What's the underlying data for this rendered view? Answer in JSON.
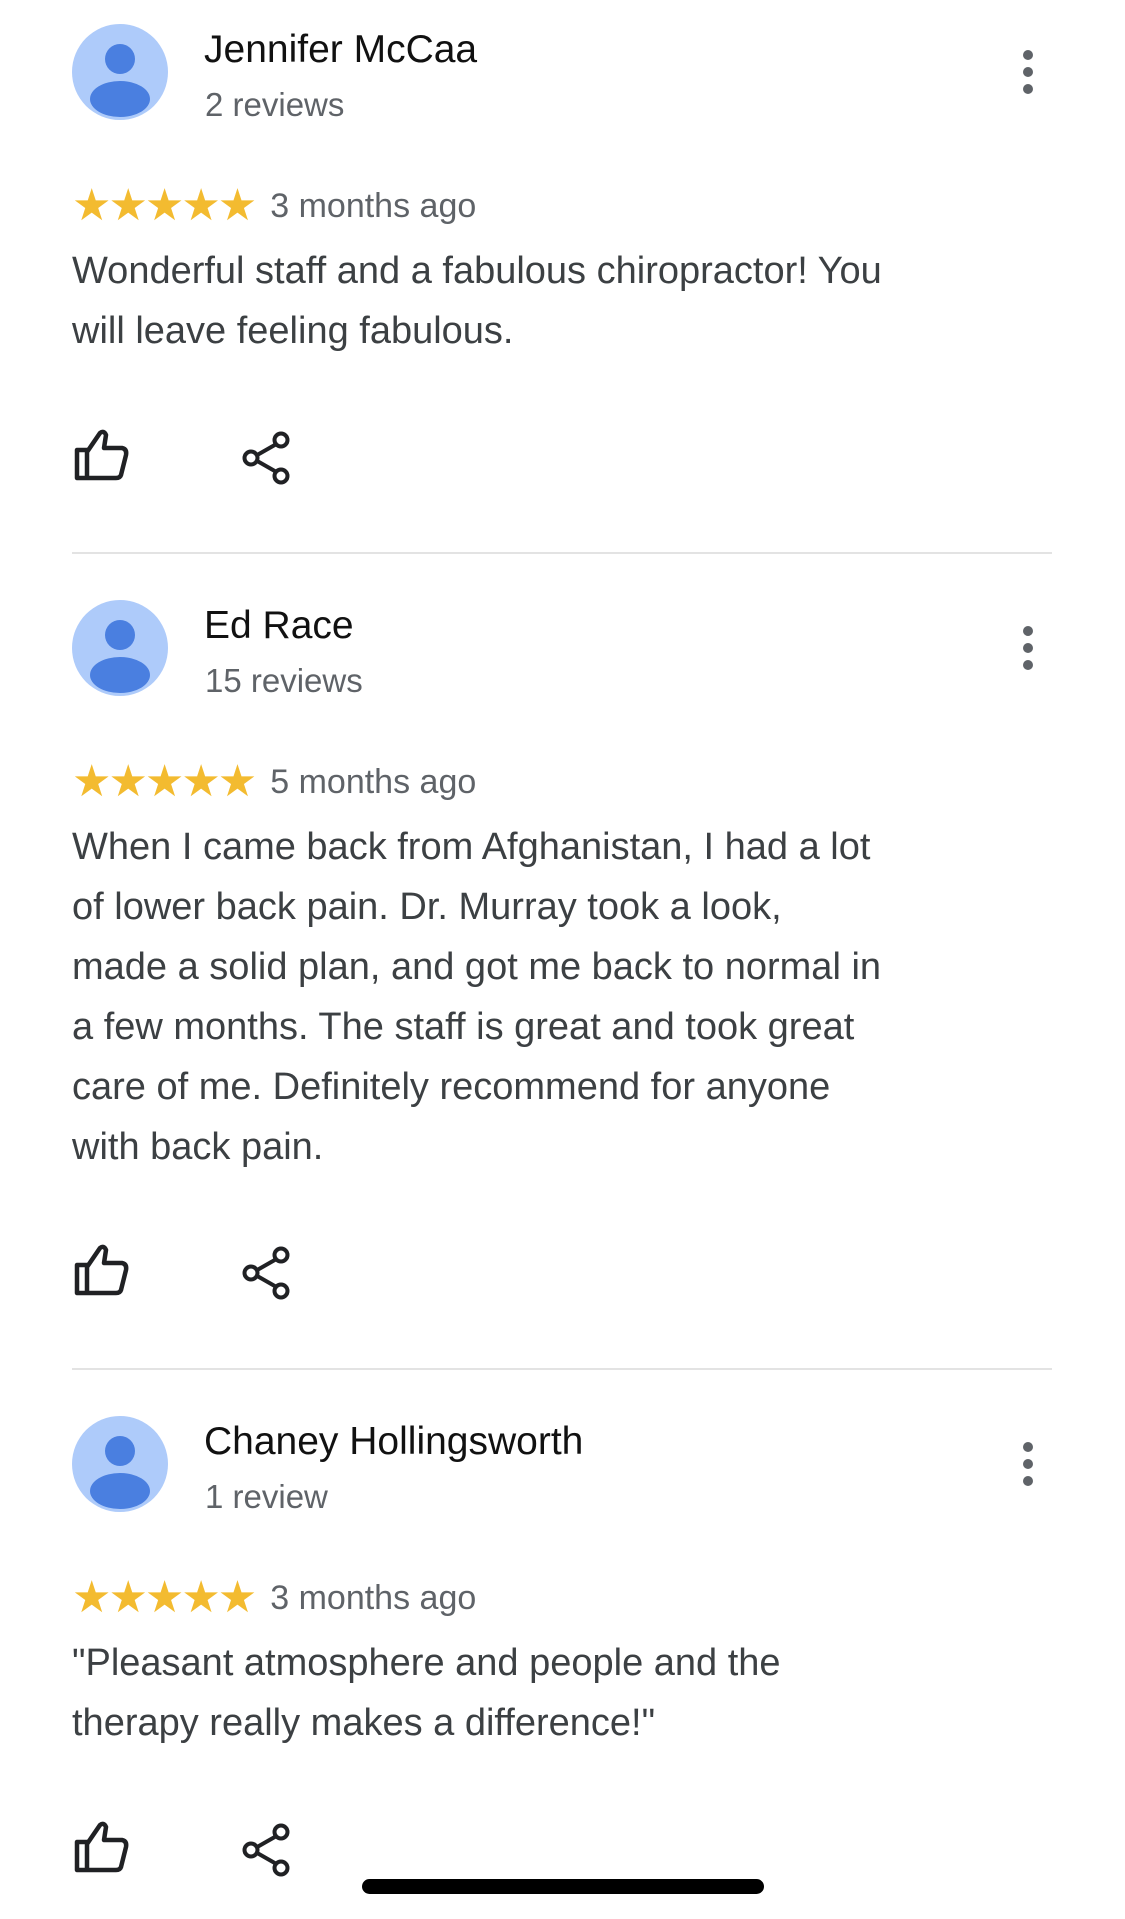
{
  "colors": {
    "star": "#f3bb30",
    "avatar_bg": "#aecbfa",
    "avatar_fg": "#4a7fe0",
    "secondary_text": "#5f6368",
    "body_text": "#3c4043",
    "divider": "#e3e3e3"
  },
  "icons": {
    "avatar": "person-avatar-icon",
    "more": "vertical-ellipsis-icon",
    "like": "thumbs-up-outline-icon",
    "share": "share-icon"
  },
  "reviews": [
    {
      "author": "Jennifer McCaa",
      "review_count": "2 reviews",
      "rating": 5,
      "stars": "★★★★★",
      "date": "3 months ago",
      "text": "Wonderful staff and a fabulous chiropractor! You\nwill leave feeling fabulous."
    },
    {
      "author": "Ed Race",
      "review_count": "15 reviews",
      "rating": 5,
      "stars": "★★★★★",
      "date": "5 months ago",
      "text": "When I came back from Afghanistan, I had a lot\nof lower back pain.  Dr. Murray took a look,\nmade a solid plan, and got me back to normal in\na few months.  The staff is great and took great\ncare of me.  Definitely recommend for anyone\nwith back pain."
    },
    {
      "author": "Chaney Hollingsworth",
      "review_count": "1 review",
      "rating": 5,
      "stars": "★★★★★",
      "date": "3 months ago",
      "text": "\"Pleasant atmosphere and people and the\ntherapy really makes a difference!\""
    }
  ]
}
